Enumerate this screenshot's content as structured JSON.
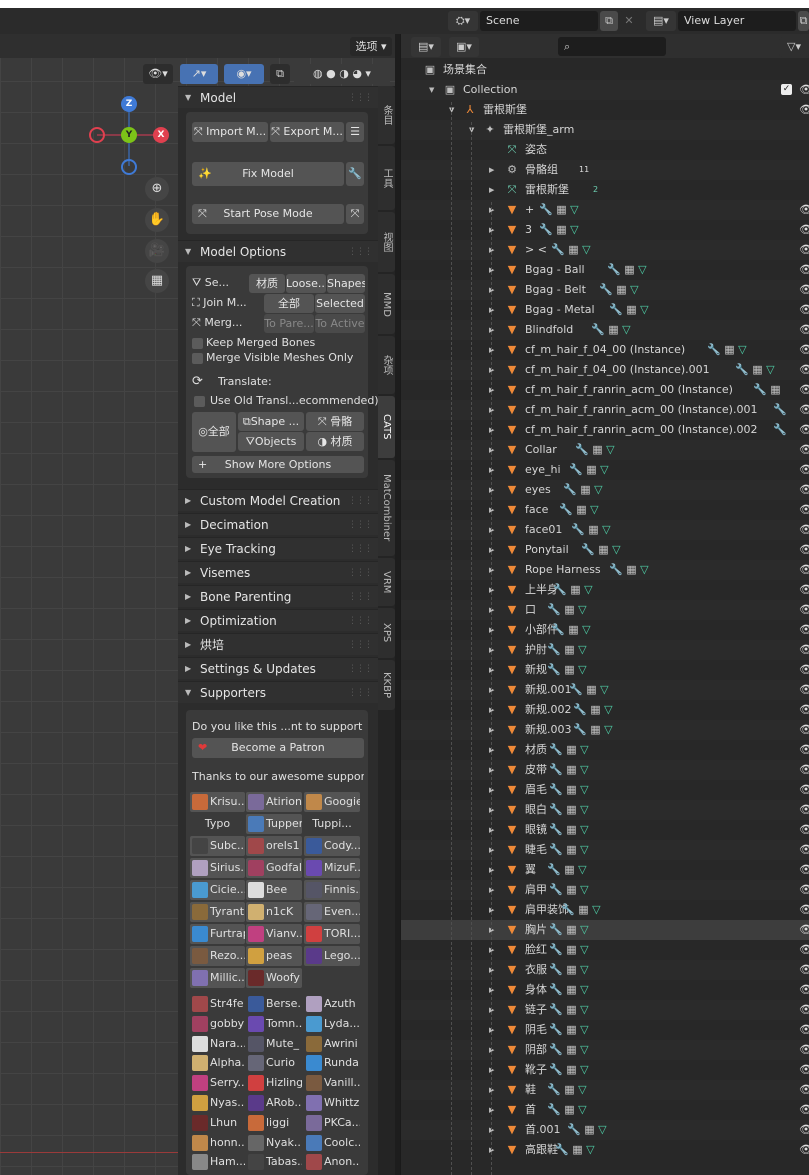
{
  "header": {
    "scene_label": "Scene",
    "view_layer_label": "View Layer"
  },
  "viewport": {
    "select_menu": "选项",
    "gizmo": {
      "x": "X",
      "y": "Y",
      "z": "Z"
    }
  },
  "side_tabs": [
    "条目",
    "工具",
    "视图",
    "MMD",
    "杂项",
    "CATS",
    "MatCombiner",
    "VRM",
    "XPS",
    "KKBP"
  ],
  "panel": {
    "model": {
      "title": "Model",
      "import_label": "Import M...",
      "export_label": "Export M...",
      "fix_label": "Fix Model",
      "pose_label": "Start Pose Mode"
    },
    "model_options": {
      "title": "Model Options",
      "row1": {
        "label": "Se...",
        "btns": [
          "材质",
          "Loose...",
          "Shapes"
        ]
      },
      "row2": {
        "label": "Join M...",
        "btns": [
          "全部",
          "Selected"
        ]
      },
      "row3": {
        "label": "Merg...",
        "btns": [
          "To Pare...",
          "To Active"
        ]
      },
      "keep_merged": "Keep Merged Bones",
      "merge_visible": "Merge Visible Meshes Only",
      "translate": "Translate:",
      "use_old": "Use Old Transl...ecommended)",
      "all": "全部",
      "shape": "Shape ...",
      "bones": "骨骼",
      "objects": "Objects",
      "materials": "材质",
      "show_more": "Show More Options"
    },
    "collapsed": [
      "Custom Model Creation",
      "Decimation",
      "Eye Tracking",
      "Visemes",
      "Bone Parenting",
      "Optimization",
      "烘培",
      "Settings & Updates"
    ],
    "supporters": {
      "title": "Supporters",
      "question": "Do you like this ...nt to support us?",
      "patron": "Become a Patron",
      "thanks": "Thanks to our awesome supporte...",
      "grid": [
        [
          "Krisu...",
          "Atirion",
          "Googie"
        ],
        [
          "Typo",
          "Tupper",
          "Tuppi..."
        ],
        [
          "Subc...",
          "orels1",
          "Cody..."
        ],
        [
          "Sirius...",
          "Godfall",
          "MizuF..."
        ],
        [
          "Cicie...",
          "Bee",
          "Finnis..."
        ],
        [
          "Tyrant",
          "n1cK",
          "Even..."
        ],
        [
          "Furtrap",
          "Vianv...",
          "TORI..."
        ],
        [
          "Rezo...",
          "peas",
          "Lego..."
        ],
        [
          "Millic...",
          "Woofy",
          ""
        ]
      ],
      "list": [
        [
          "Str4fe",
          "Berse...",
          "Azuth"
        ],
        [
          "gobby",
          "Tomn...",
          "Lyda..."
        ],
        [
          "Nara...",
          "Mute_",
          "Awrini"
        ],
        [
          "Alpha...",
          "Curio",
          "Runda"
        ],
        [
          "Serry...",
          "Hizling",
          "Vanill..."
        ],
        [
          "Nyas...",
          "ARob...",
          "Whittz"
        ],
        [
          "Lhun",
          "liggi",
          "PKCa..."
        ],
        [
          "honn...",
          "Nyak...",
          "Coolc..."
        ],
        [
          "Ham...",
          "Tabas...",
          "Anon..."
        ]
      ]
    }
  },
  "outliner": {
    "scene_collection": "场景集合",
    "collection": "Collection",
    "armature_obj": "雷根斯堡",
    "armature_data": "雷根斯堡_arm",
    "pose": "姿态",
    "bone_groups": "骨骼组",
    "bone_groups_count": "11",
    "armature_sub": "雷根斯堡",
    "armature_sub_count": "2",
    "meshes": [
      "+",
      "3",
      "> <",
      "Bgag - Ball",
      "Bgag - Belt",
      "Bgag - Metal",
      "Blindfold",
      "cf_m_hair_f_04_00 (Instance)",
      "cf_m_hair_f_04_00 (Instance).001",
      "cf_m_hair_f_ranrin_acm_00 (Instance)",
      "cf_m_hair_f_ranrin_acm_00 (Instance).001",
      "cf_m_hair_f_ranrin_acm_00 (Instance).002",
      "Collar",
      "eye_hi",
      "eyes",
      "face",
      "face01",
      "Ponytail",
      "Rope Harness",
      "上半身",
      "口",
      "小部件",
      "护肘",
      "新规",
      "新规.001",
      "新规.002",
      "新规.003",
      "材质",
      "皮带",
      "眉毛",
      "眼白",
      "眼镜",
      "睫毛",
      "翼",
      "肩甲",
      "肩甲装饰",
      "胸片",
      "脸红",
      "衣服",
      "身体",
      "链子",
      "阴毛",
      "阴部",
      "靴子",
      "鞋",
      "首",
      "首.001",
      "高跟鞋"
    ],
    "selected": "胸片"
  }
}
